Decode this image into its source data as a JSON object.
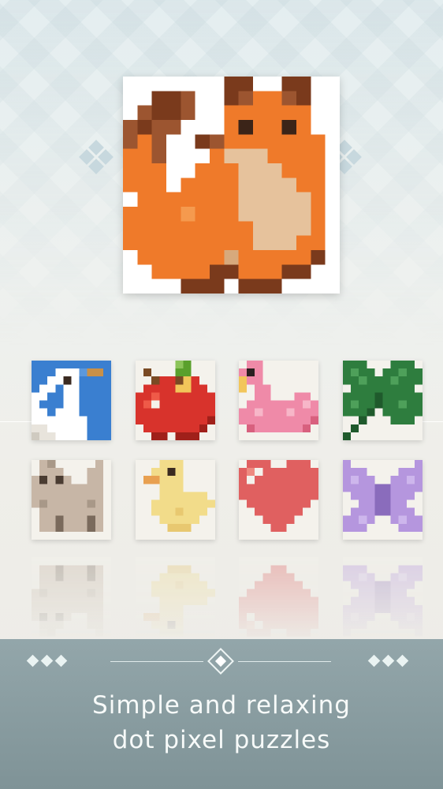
{
  "featured_puzzle": {
    "subject": "fox-icon"
  },
  "puzzle_grid": {
    "row1": [
      {
        "subject": "swan-icon"
      },
      {
        "subject": "apple-icon"
      },
      {
        "subject": "flamingo-float-icon"
      },
      {
        "subject": "clover-icon"
      }
    ],
    "row2": [
      {
        "subject": "cat-icon"
      },
      {
        "subject": "duck-icon"
      },
      {
        "subject": "heart-icon"
      },
      {
        "subject": "butterfly-icon"
      }
    ]
  },
  "colors": {
    "footer": "#8a9da1",
    "fox_orange": "#ef7a2a",
    "fox_brown": "#7a3a1c",
    "fox_beige": "#e6c29c"
  },
  "footer": {
    "line1": "Simple and relaxing",
    "line2": "dot pixel puzzles"
  }
}
